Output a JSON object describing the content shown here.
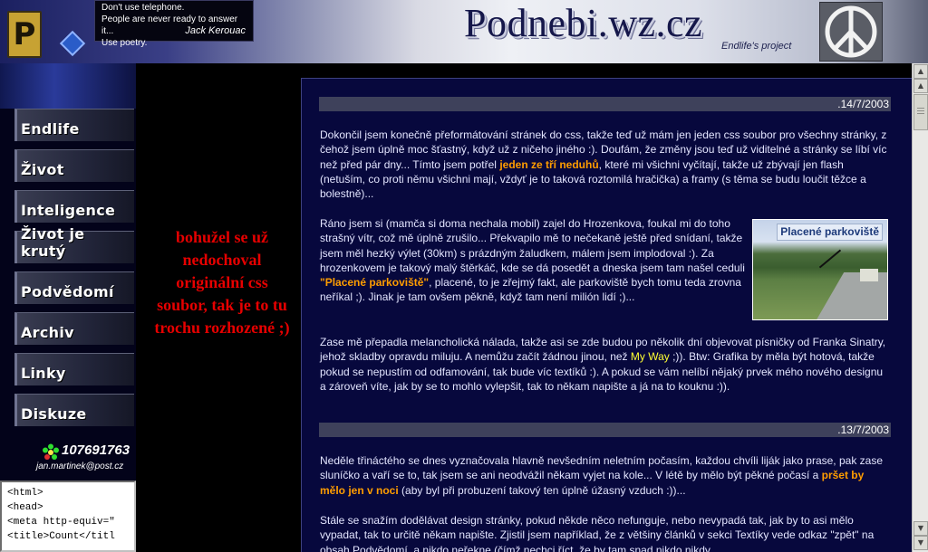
{
  "header": {
    "logo_letter": "P",
    "quote_lines": [
      "Don't use telephone.",
      "People are never ready to answer it...",
      "Use poetry."
    ],
    "quote_author": "Jack Kerouac",
    "site_title": "Podnebi.wz.cz",
    "site_subtitle": "Endlife's project"
  },
  "sidebar": {
    "nav": [
      {
        "label": "Endlife"
      },
      {
        "label": "Život"
      },
      {
        "label": "Inteligence"
      },
      {
        "label": "Život je krutý"
      },
      {
        "label": "Podvědomí"
      },
      {
        "label": "Archiv"
      },
      {
        "label": "Linky"
      },
      {
        "label": "Diskuze"
      }
    ],
    "icq_number": "107691763",
    "email": "jan.martinek@post.cz",
    "source_lines": [
      "<html>",
      "",
      "<head>",
      "<meta http-equiv=\"",
      "<title>Count</titl"
    ]
  },
  "notice": "bohužel se už nedochoval originální css soubor, tak je to tu trochu rozhozené ;)",
  "posts": [
    {
      "date": ".14/7/2003",
      "p1": {
        "t1": " Dokončil jsem konečně přeformátování stránek do css, takže teď už mám jen jeden css soubor pro všechny stránky, z čehož jsem úplně moc šťastný, když už z ničeho jiného :). Doufám, že změny jsou teď už viditelné a stránky se líbí víc než před pár dny... Tímto jsem potřel ",
        "h1": "jeden ze tří neduhů",
        "t2": ", které mi všichni vyčítají, takže už zbývají jen flash (netuším, co proti němu všichni mají, vždyť je to taková roztomilá hračička) a framy (s těma se budu loučit těžce a bolestně)..."
      },
      "p2": {
        "t1": " Ráno jsem si (mamča si doma nechala mobil) zajel do Hrozenkova, foukal mi do toho strašný vítr, což mě úplně zrušilo... Překvapilo mě to nečekaně ještě před snídaní, takže jsem měl hezký výlet (30km) s prázdným žaludkem, málem jsem implodoval :). Za hrozenkovem je takový malý štěrkáč, kde se dá posedět a dneska jsem tam našel ceduli ",
        "h1": "\"Placené parkoviště\"",
        "t2": ", placené, to je zřejmý fakt, ale parkoviště bych tomu teda zrovna neříkal ;). Jinak je tam ovšem pěkně, když tam není milión lidí ;)..."
      },
      "image_label": "Placené parkoviště",
      "p3": {
        "t1": " Zase mě přepadla melancholická nálada, takže asi se zde budou po několik dní objevovat písničky od Franka Sinatry, jehož skladby opravdu miluju. A nemůžu začít žádnou jinou, než ",
        "h1": "My Way",
        "t2": " ;)). Btw: Grafika by měla být hotová, takže pokud se nepustím od odfamování, tak bude víc textíků :). A pokud se vám nelíbí nějaký prvek mého nového designu a zároveň víte, jak by se to mohlo vylepšit, tak to někam napište a já na to kouknu :))."
      }
    },
    {
      "date": ".13/7/2003",
      "p1": {
        "t1": " Neděle třináctého se dnes vyznačovala hlavně nevšedním neletním počasím, každou chvíli liják jako prase, pak zase sluníčko a vaří se to, tak jsem se ani neodvážil někam vyjet na kole... V létě by mělo být pěkné počasí a ",
        "h1": "pršet by mělo jen v noci",
        "t2": " (aby byl při probuzení takový ten úplně úžasný vzduch :))..."
      },
      "p2": {
        "t1": " Stále se snažím dodělávat design stránky, pokud někde něco nefunguje, nebo nevypadá tak, jak by to asi mělo vypadat, tak to určitě někam napište. Zjistil jsem například, že z většiny článků v sekci Textíky vede odkaz \"zpět\" na obsah Podvědomí, a nikdo neřekne (čímž nechci říct, že by tam snad nikdo nikdy"
      }
    }
  ],
  "colors": {
    "content_bg": "#07083d",
    "date_bar": "#3e415b",
    "highlight_orange": "#ff9d00",
    "highlight_yellow": "#ffff33",
    "notice_red": "#e60000"
  }
}
